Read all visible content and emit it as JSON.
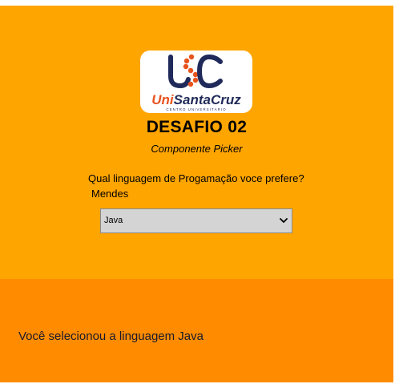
{
  "logo": {
    "monogram": "USC",
    "brand_uni": "Uni",
    "brand_rest": "SantaCruz",
    "tagline": "CENTRO UNIVERSITÁRIO"
  },
  "header": {
    "title": "DESAFIO 02",
    "subtitle": "Componente Picker"
  },
  "form": {
    "question": "Qual linguagem de Progamação voce prefere?",
    "name": "Mendes",
    "picker": {
      "selected": "Java"
    }
  },
  "result": {
    "prefix": "Você selecionou a linguagem",
    "value": "Java",
    "full": "Você selecionou a linguagem Java"
  },
  "colors": {
    "top_background": "#FFA500",
    "bottom_background": "#FF8C00",
    "logo_navy": "#1f2a5a",
    "logo_orange": "#e8541e"
  }
}
